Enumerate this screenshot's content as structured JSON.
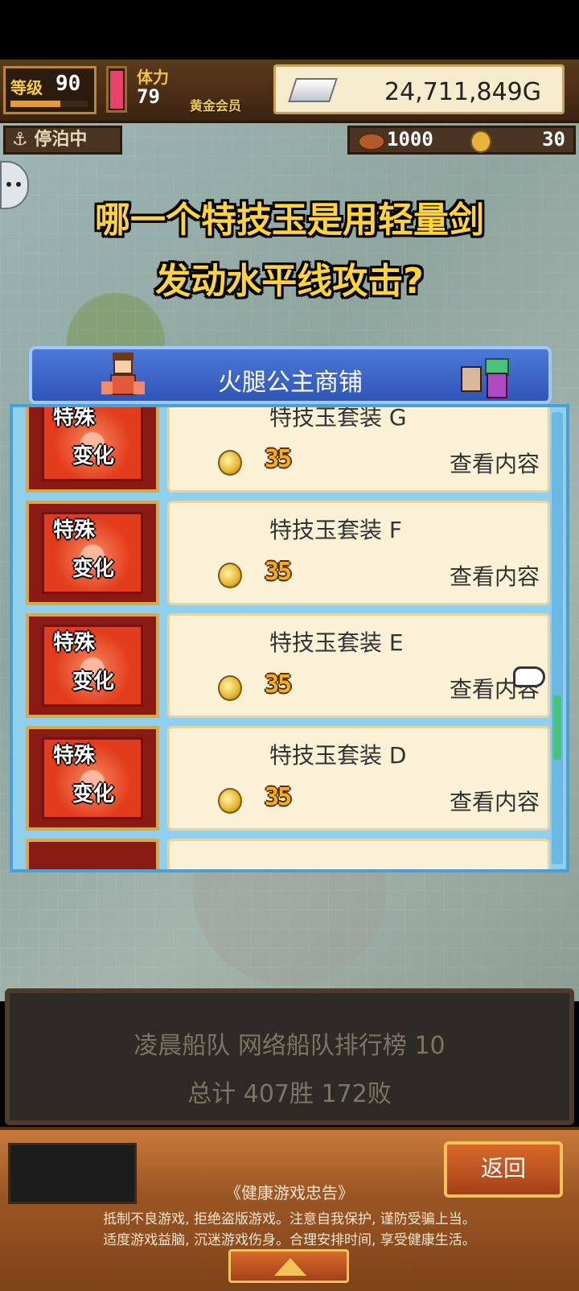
{
  "hud": {
    "level_label": "等级",
    "level_value": "90",
    "level_progress": 0.65,
    "hp_fill": 0.95,
    "stamina_label": "体力",
    "stamina_value": "79",
    "member_label": "黄金会员",
    "gold": "24,711,849G",
    "dock_status": "停泊中",
    "resource_a": "1000",
    "resource_b": "30"
  },
  "question": {
    "line1": "哪一个特技玉是用轻量剑",
    "line2": "发动水平线攻击?"
  },
  "shop": {
    "title": "火腿公主商铺",
    "icon_text1": "特殊",
    "icon_text2": "变化",
    "items": [
      {
        "name": "特技玉套装  G",
        "price": "35",
        "action": "查看内容"
      },
      {
        "name": "特技玉套装  F",
        "price": "35",
        "action": "查看内容"
      },
      {
        "name": "特技玉套装  E",
        "price": "35",
        "action": "查看内容"
      },
      {
        "name": "特技玉套装  D",
        "price": "35",
        "action": "查看内容"
      }
    ]
  },
  "ranking": {
    "line1": "凌晨船队  网络船队排行榜  10",
    "line2": "总计 407胜 172败"
  },
  "footer": {
    "back_label": "返回",
    "advice_title": "《健康游戏忠告》",
    "advice_line1": "抵制不良游戏, 拒绝盗版游戏。注意自我保护, 谨防受骗上当。",
    "advice_line2": "适度游戏益脑, 沉迷游戏伤身。合理安排时间, 享受健康生活。"
  }
}
